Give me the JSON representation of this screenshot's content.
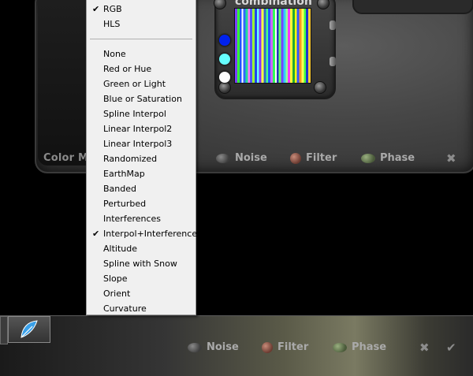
{
  "top_panel": {
    "color_mode_label": "Color Mo",
    "preview_title": "combination",
    "buttons": [
      {
        "label": "Noise",
        "icon": "stone-icon"
      },
      {
        "label": "Filter",
        "icon": "red-stone-icon"
      },
      {
        "label": "Phase",
        "icon": "green-stone-icon"
      }
    ],
    "close": "✖",
    "swatches": [
      "#0022ee",
      "#66ffff",
      "#ffffff"
    ]
  },
  "context_menu": {
    "group1": [
      {
        "label": "RGB",
        "checked": "✔"
      },
      {
        "label": "HLS",
        "checked": ""
      }
    ],
    "group2": [
      {
        "label": "None",
        "checked": ""
      },
      {
        "label": "Red or Hue",
        "checked": ""
      },
      {
        "label": "Green or Light",
        "checked": ""
      },
      {
        "label": "Blue or Saturation",
        "checked": ""
      },
      {
        "label": "Spline Interpol",
        "checked": ""
      },
      {
        "label": "Linear Interpol2",
        "checked": ""
      },
      {
        "label": "Linear Interpol3",
        "checked": ""
      },
      {
        "label": "Randomized",
        "checked": ""
      },
      {
        "label": "EarthMap",
        "checked": ""
      },
      {
        "label": "Banded",
        "checked": ""
      },
      {
        "label": "Perturbed",
        "checked": ""
      },
      {
        "label": "Interferences",
        "checked": ""
      },
      {
        "label": "Interpol+Interferences",
        "checked": "✔"
      },
      {
        "label": "Altitude",
        "checked": ""
      },
      {
        "label": "Spline with Snow",
        "checked": ""
      },
      {
        "label": "Slope",
        "checked": ""
      },
      {
        "label": "Orient",
        "checked": ""
      },
      {
        "label": "Curvature",
        "checked": ""
      }
    ]
  },
  "taskbar": {
    "app_icon": "feather-icon",
    "buttons": [
      {
        "label": "Noise"
      },
      {
        "label": "Filter"
      },
      {
        "label": "Phase"
      }
    ],
    "close": "✖",
    "ok": "✔"
  }
}
